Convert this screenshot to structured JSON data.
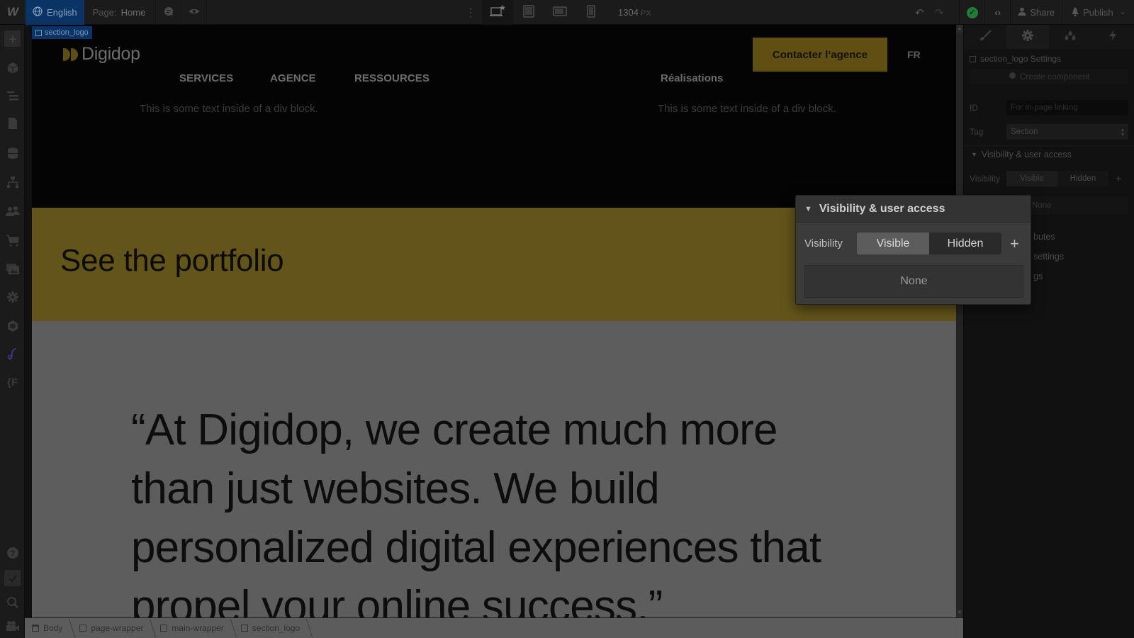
{
  "topbar": {
    "logo": "W",
    "locale": "English",
    "page_label": "Page:",
    "page_name": "Home",
    "canvas_width": "1304",
    "canvas_width_unit": "PX",
    "share_label": "Share",
    "publish_label": "Publish",
    "breakpoints": [
      "desktop-base",
      "tablet",
      "mobile-landscape",
      "mobile-portrait"
    ],
    "status_color": "#1e7c37"
  },
  "left_rail": {
    "items": [
      "add-elements",
      "components",
      "navigator",
      "pages",
      "cms",
      "logic",
      "users",
      "ecommerce",
      "assets",
      "settings",
      "apps",
      "finsweet",
      "code"
    ],
    "bottom_items": [
      "help",
      "audits",
      "search",
      "video-tutorials"
    ]
  },
  "canvas": {
    "selected_element": "section_logo",
    "site": {
      "logo_text": "Digidop",
      "nav": [
        "SERVICES",
        "AGENCE",
        "RESSOURCES"
      ],
      "realisations": "Réalisations",
      "cta": "Contacter l’agence",
      "lang": "FR",
      "div_text_1": "This is some text inside of a div block.",
      "div_text_2": "This is some text inside of a div block.",
      "portfolio_heading": "See the portfolio",
      "quote": "“At Digidop, we create much more than just websites. We build personalized digital experiences that propel your online success.”",
      "accent_color": "#c9a52b"
    }
  },
  "breadcrumb": [
    "Body",
    "page-wrapper",
    "main-wrapper",
    "section_logo"
  ],
  "right_panel": {
    "tabs": [
      "style",
      "settings",
      "interactions",
      "lightning"
    ],
    "active_tab": "settings",
    "title": "section_logo Settings",
    "create_component": "Create component",
    "id_label": "ID",
    "id_placeholder": "For in-page linking",
    "tag_label": "Tag",
    "tag_value": "Section",
    "section_title": "Visibility & user access",
    "visibility_label": "Visibility",
    "visible_label": "Visible",
    "hidden_label": "Hidden",
    "none_label": "None",
    "fragments": [
      "butes",
      "settings",
      "gs"
    ]
  },
  "popup": {
    "title": "Visibility & user access",
    "visibility_label": "Visibility",
    "visible_label": "Visible",
    "hidden_label": "Hidden",
    "none_label": "None"
  }
}
